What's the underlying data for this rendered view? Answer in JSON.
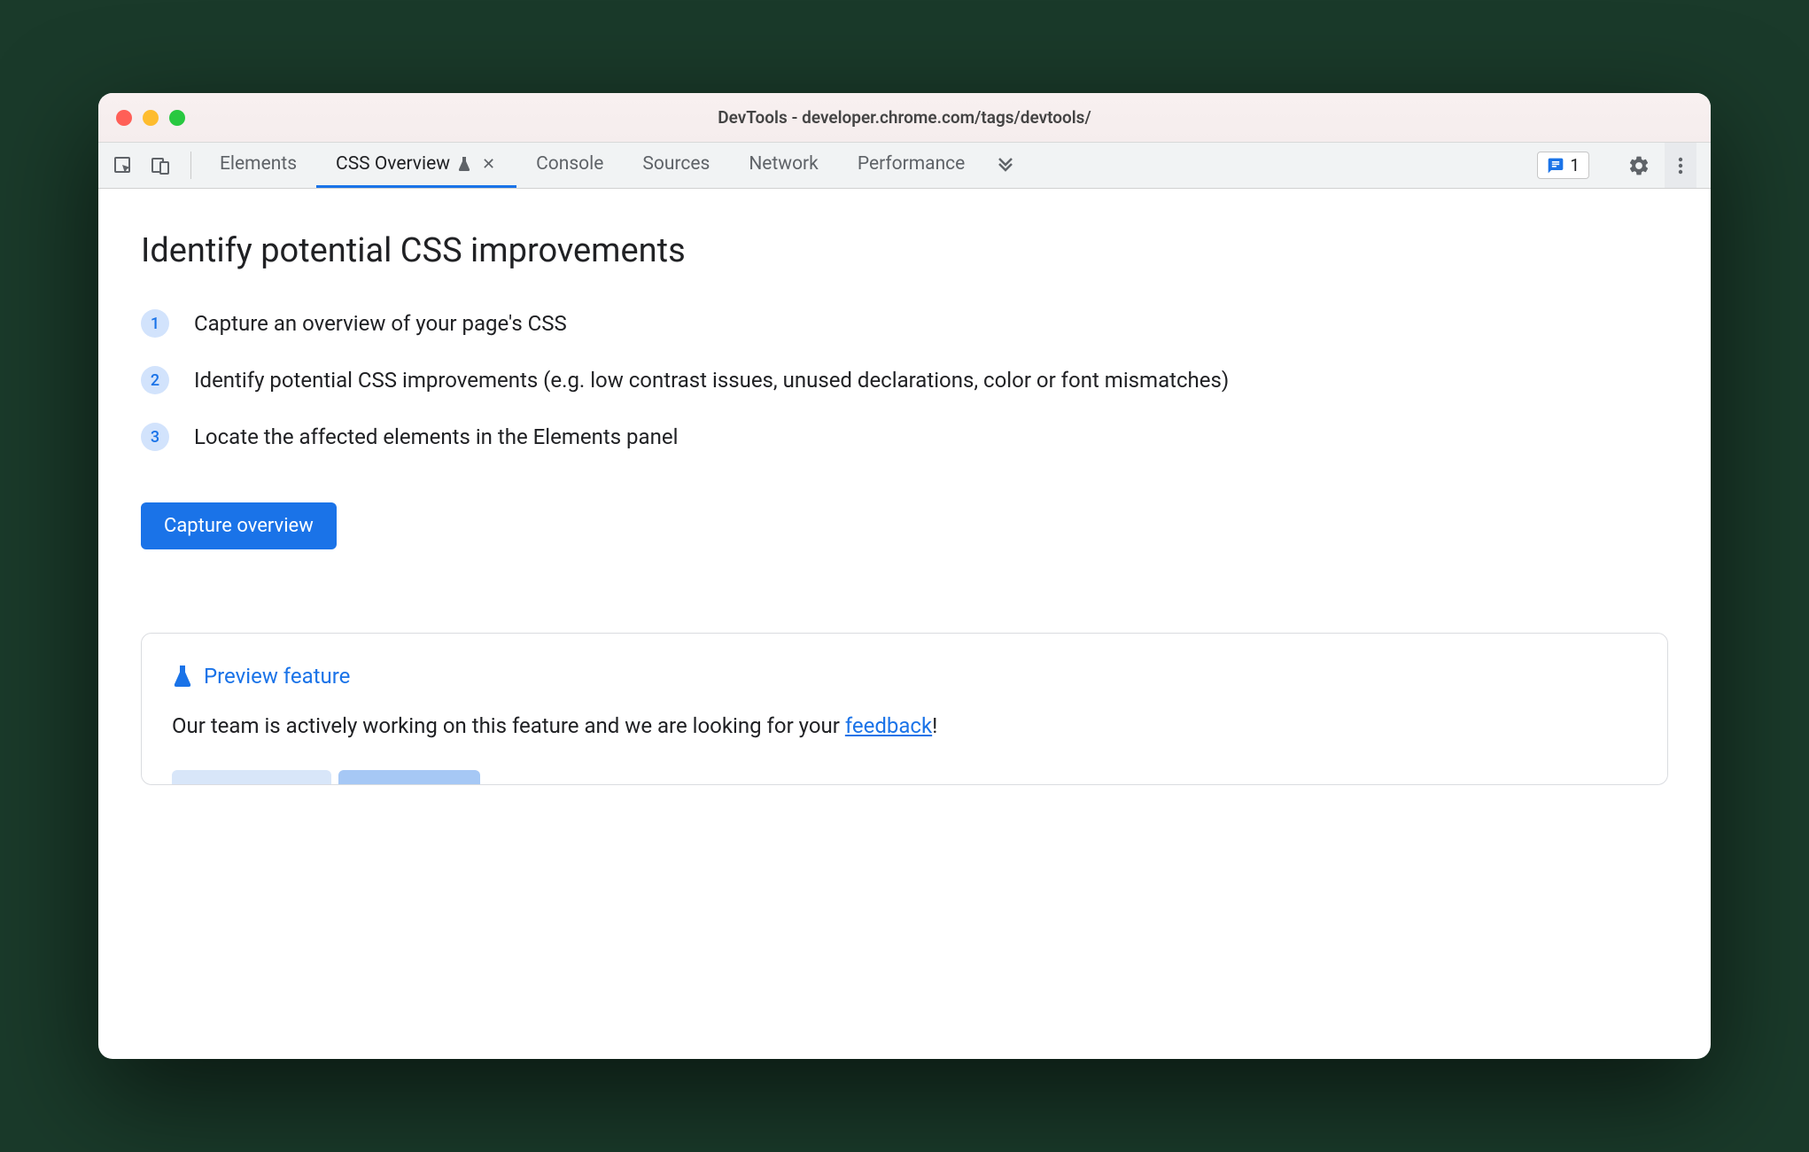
{
  "window": {
    "title": "DevTools - developer.chrome.com/tags/devtools/"
  },
  "toolbar": {
    "tabs": [
      {
        "label": "Elements",
        "active": false,
        "experimental": false,
        "closable": false
      },
      {
        "label": "CSS Overview",
        "active": true,
        "experimental": true,
        "closable": true
      },
      {
        "label": "Console",
        "active": false,
        "experimental": false,
        "closable": false
      },
      {
        "label": "Sources",
        "active": false,
        "experimental": false,
        "closable": false
      },
      {
        "label": "Network",
        "active": false,
        "experimental": false,
        "closable": false
      },
      {
        "label": "Performance",
        "active": false,
        "experimental": false,
        "closable": false
      }
    ],
    "feedback_count": "1"
  },
  "main": {
    "title": "Identify potential CSS improvements",
    "steps": [
      {
        "num": "1",
        "text": "Capture an overview of your page's CSS"
      },
      {
        "num": "2",
        "text": "Identify potential CSS improvements (e.g. low contrast issues, unused declarations, color or font mismatches)"
      },
      {
        "num": "3",
        "text": "Locate the affected elements in the Elements panel"
      }
    ],
    "capture_button": "Capture overview"
  },
  "preview": {
    "title": "Preview feature",
    "body_prefix": "Our team is actively working on this feature and we are looking for your ",
    "link_text": "feedback",
    "body_suffix": "!"
  }
}
